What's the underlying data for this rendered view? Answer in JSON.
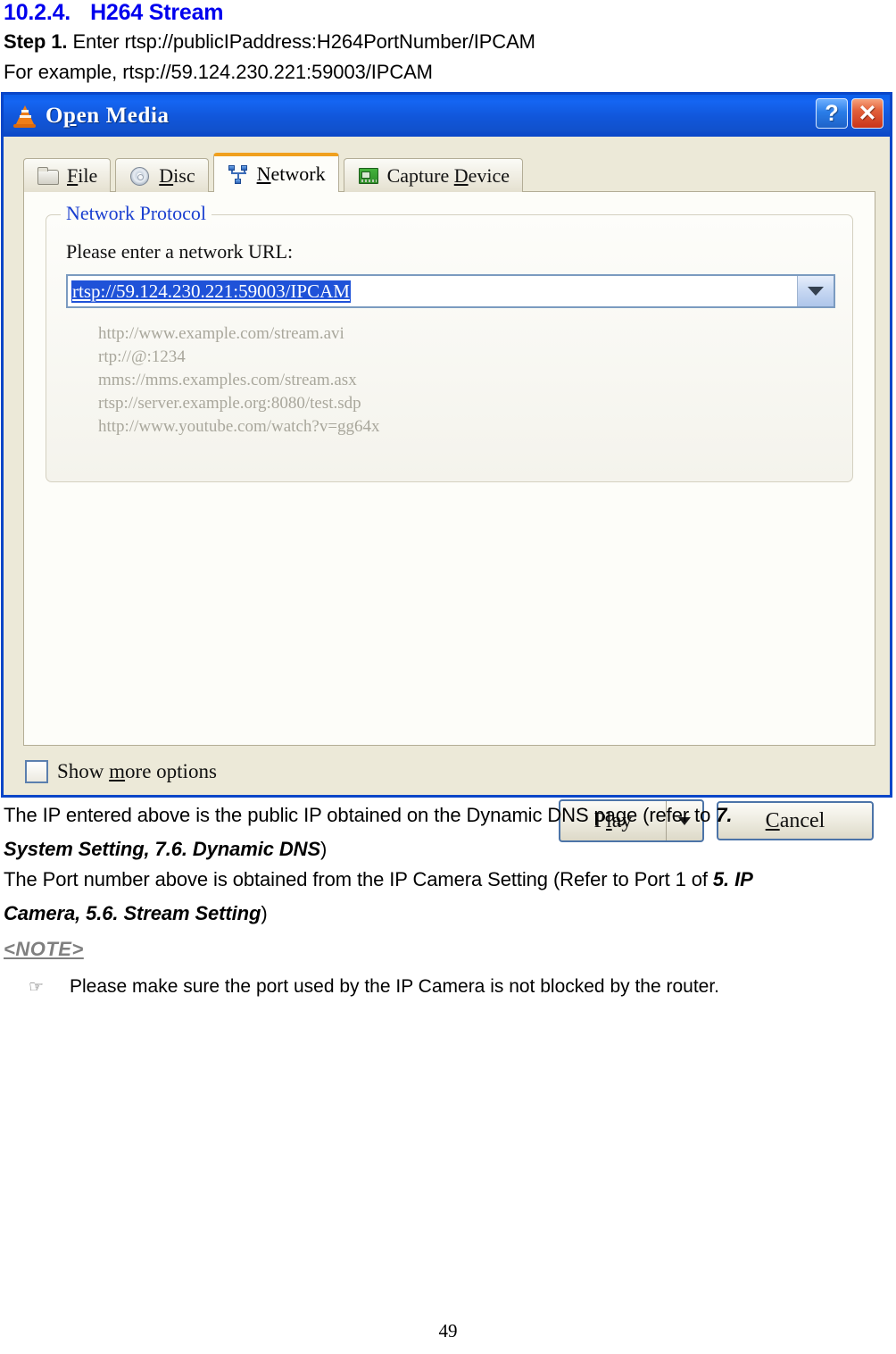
{
  "document": {
    "heading_number": "10.2.4.",
    "heading_title": "H264 Stream",
    "step_label": "Step 1.",
    "step_text": " Enter rtsp://publicIPaddress:H264PortNumber/IPCAM",
    "example_line": "For example, rtsp://59.124.230.221:59003/IPCAM",
    "para1_a_plain": "The IP entered above is the public IP obtained on the Dynamic DNS page (refer to ",
    "para1_a_bold": "7.",
    "para1_b_bold": "System Setting, 7.6. Dynamic DNS",
    "para1_b_plain": ")",
    "para2_a_plain": "The Port number above is obtained from the IP Camera Setting (Refer to Port 1 of ",
    "para2_a_bold": "5. IP",
    "para2_b_bold": "Camera, 5.6. Stream Setting",
    "para2_b_plain": ")",
    "note_label": "<NOTE>",
    "bullet_glyph": "☞",
    "bullet_text": "Please make sure the port used by the IP Camera is not blocked by the router.",
    "page_number": "49"
  },
  "dialog": {
    "title": "Open Media",
    "title_accesskey_prefix": "O",
    "title_accesskey_letter": "p",
    "title_accesskey_suffix": "en Media",
    "help_button": "?",
    "close_button": "✕",
    "tabs": [
      {
        "label_before": "",
        "label_key": "F",
        "label_after": "ile",
        "icon": "folder-icon",
        "active": false
      },
      {
        "label_before": "",
        "label_key": "D",
        "label_after": "isc",
        "icon": "disc-icon",
        "active": false
      },
      {
        "label_before": "",
        "label_key": "N",
        "label_after": "etwork",
        "icon": "network-icon",
        "active": true
      },
      {
        "label_before": "Capture ",
        "label_key": "D",
        "label_after": "evice",
        "icon": "capture-card-icon",
        "active": false
      }
    ],
    "group": {
      "title": "Network Protocol",
      "label": "Please enter a network URL:",
      "url_value": "rtsp://59.124.230.221:59003/IPCAM",
      "url_selected": true,
      "examples": "http://www.example.com/stream.avi\nrtp://@:1234\nmms://mms.examples.com/stream.asx\nrtsp://server.example.org:8080/test.sdp\nhttp://www.youtube.com/watch?v=gg64x"
    },
    "show_more": {
      "label_before": "Show ",
      "label_key": "m",
      "label_after": "ore options",
      "checked": false
    },
    "buttons": {
      "play_before": "P",
      "play_key": "l",
      "play_after": "ay",
      "cancel_before": "",
      "cancel_key": "C",
      "cancel_after": "ancel"
    }
  },
  "colors": {
    "heading_blue": "#0000ee",
    "titlebar_blue": "#1157db",
    "group_title_blue": "#1a3fd0",
    "selection_blue": "#1f52d8",
    "tab_active_accent": "#f0a01e",
    "note_gray": "#808080",
    "dialog_face": "#ece9d8"
  }
}
